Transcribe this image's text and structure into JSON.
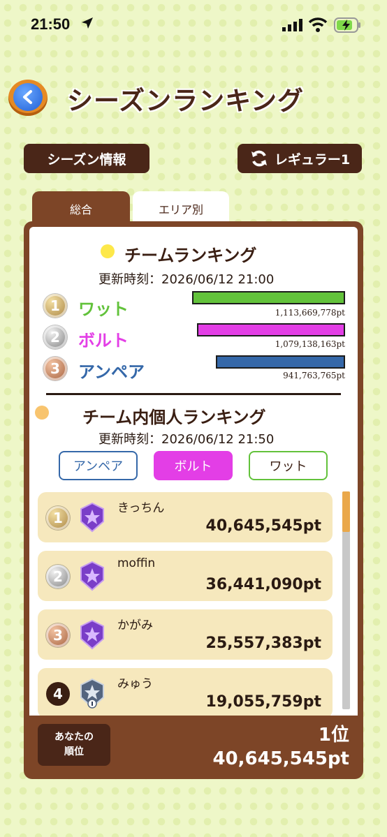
{
  "status_bar": {
    "time": "21:50"
  },
  "header": {
    "title": "シーズンランキング"
  },
  "buttons": {
    "season_info": "シーズン情報",
    "regular": "レギュラー1"
  },
  "tabs": [
    {
      "label": "総合",
      "active": true
    },
    {
      "label": "エリア別",
      "active": false
    }
  ],
  "team_ranking": {
    "title": "チームランキング",
    "updated": "更新時刻：2026/06/12 21:00",
    "teams": [
      {
        "rank": "1",
        "name": "ワット",
        "points": "1,113,669,778pt",
        "value": 1113669778,
        "color": "#62c23b"
      },
      {
        "rank": "2",
        "name": "ボルト",
        "points": "1,079,138,163pt",
        "value": 1079138163,
        "color": "#e33ee6"
      },
      {
        "rank": "3",
        "name": "アンペア",
        "points": "941,763,765pt",
        "value": 941763765,
        "color": "#3568a9"
      }
    ]
  },
  "individual_ranking": {
    "title": "チーム内個人ランキング",
    "updated": "更新時刻：2026/06/12 21:50",
    "filters": [
      {
        "label": "アンペア",
        "selected": false,
        "color": "#3568a9"
      },
      {
        "label": "ボルト",
        "selected": true,
        "color": "#e33ee6"
      },
      {
        "label": "ワット",
        "selected": false,
        "color": "#62c23b"
      }
    ],
    "players": [
      {
        "rank": "1",
        "name": "きっちん",
        "points": "40,645,545pt",
        "badge": "purple-star-badge-icon"
      },
      {
        "rank": "2",
        "name": "moffin",
        "points": "36,441,090pt",
        "badge": "purple-star-badge-icon"
      },
      {
        "rank": "3",
        "name": "かがみ",
        "points": "25,557,383pt",
        "badge": "purple-star-badge-icon"
      },
      {
        "rank": "4",
        "name": "みゅう",
        "points": "19,055,759pt",
        "badge": "silver-star-badge-icon"
      }
    ]
  },
  "your_rank": {
    "label_line1": "あなたの",
    "label_line2": "順位",
    "rank": "1位",
    "points": "40,645,545pt"
  }
}
